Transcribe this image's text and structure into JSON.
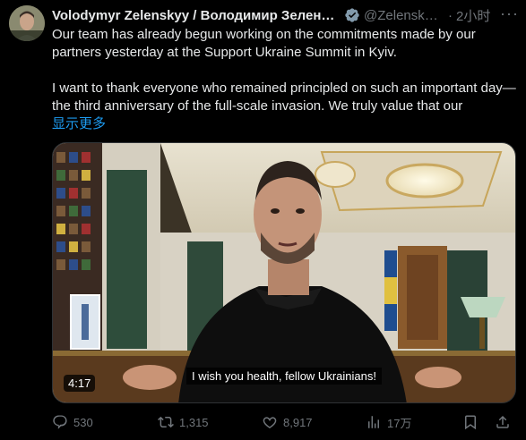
{
  "author": {
    "name": "Volodymyr Zelenskyy / Володимир Зеленс…",
    "handle": "@Zelensky…",
    "time": "2小时"
  },
  "tweet": {
    "paragraph1": "Our team has already begun working on the commitments made by our partners yesterday at the Support Ukraine Summit in Kyiv.",
    "paragraph2": "I want to thank everyone who remained principled on such an important day—the third anniversary of the full-scale invasion. We truly value that our",
    "show_more": "显示更多"
  },
  "video": {
    "duration": "4:17",
    "caption": "I wish you health, fellow Ukrainians!"
  },
  "stats": {
    "replies": "530",
    "reposts": "1,315",
    "likes": "8,917",
    "views": "17万"
  },
  "colors": {
    "background": "#000000",
    "text": "#e7e9ea",
    "muted": "#71767b",
    "accent": "#1d9bf0"
  }
}
